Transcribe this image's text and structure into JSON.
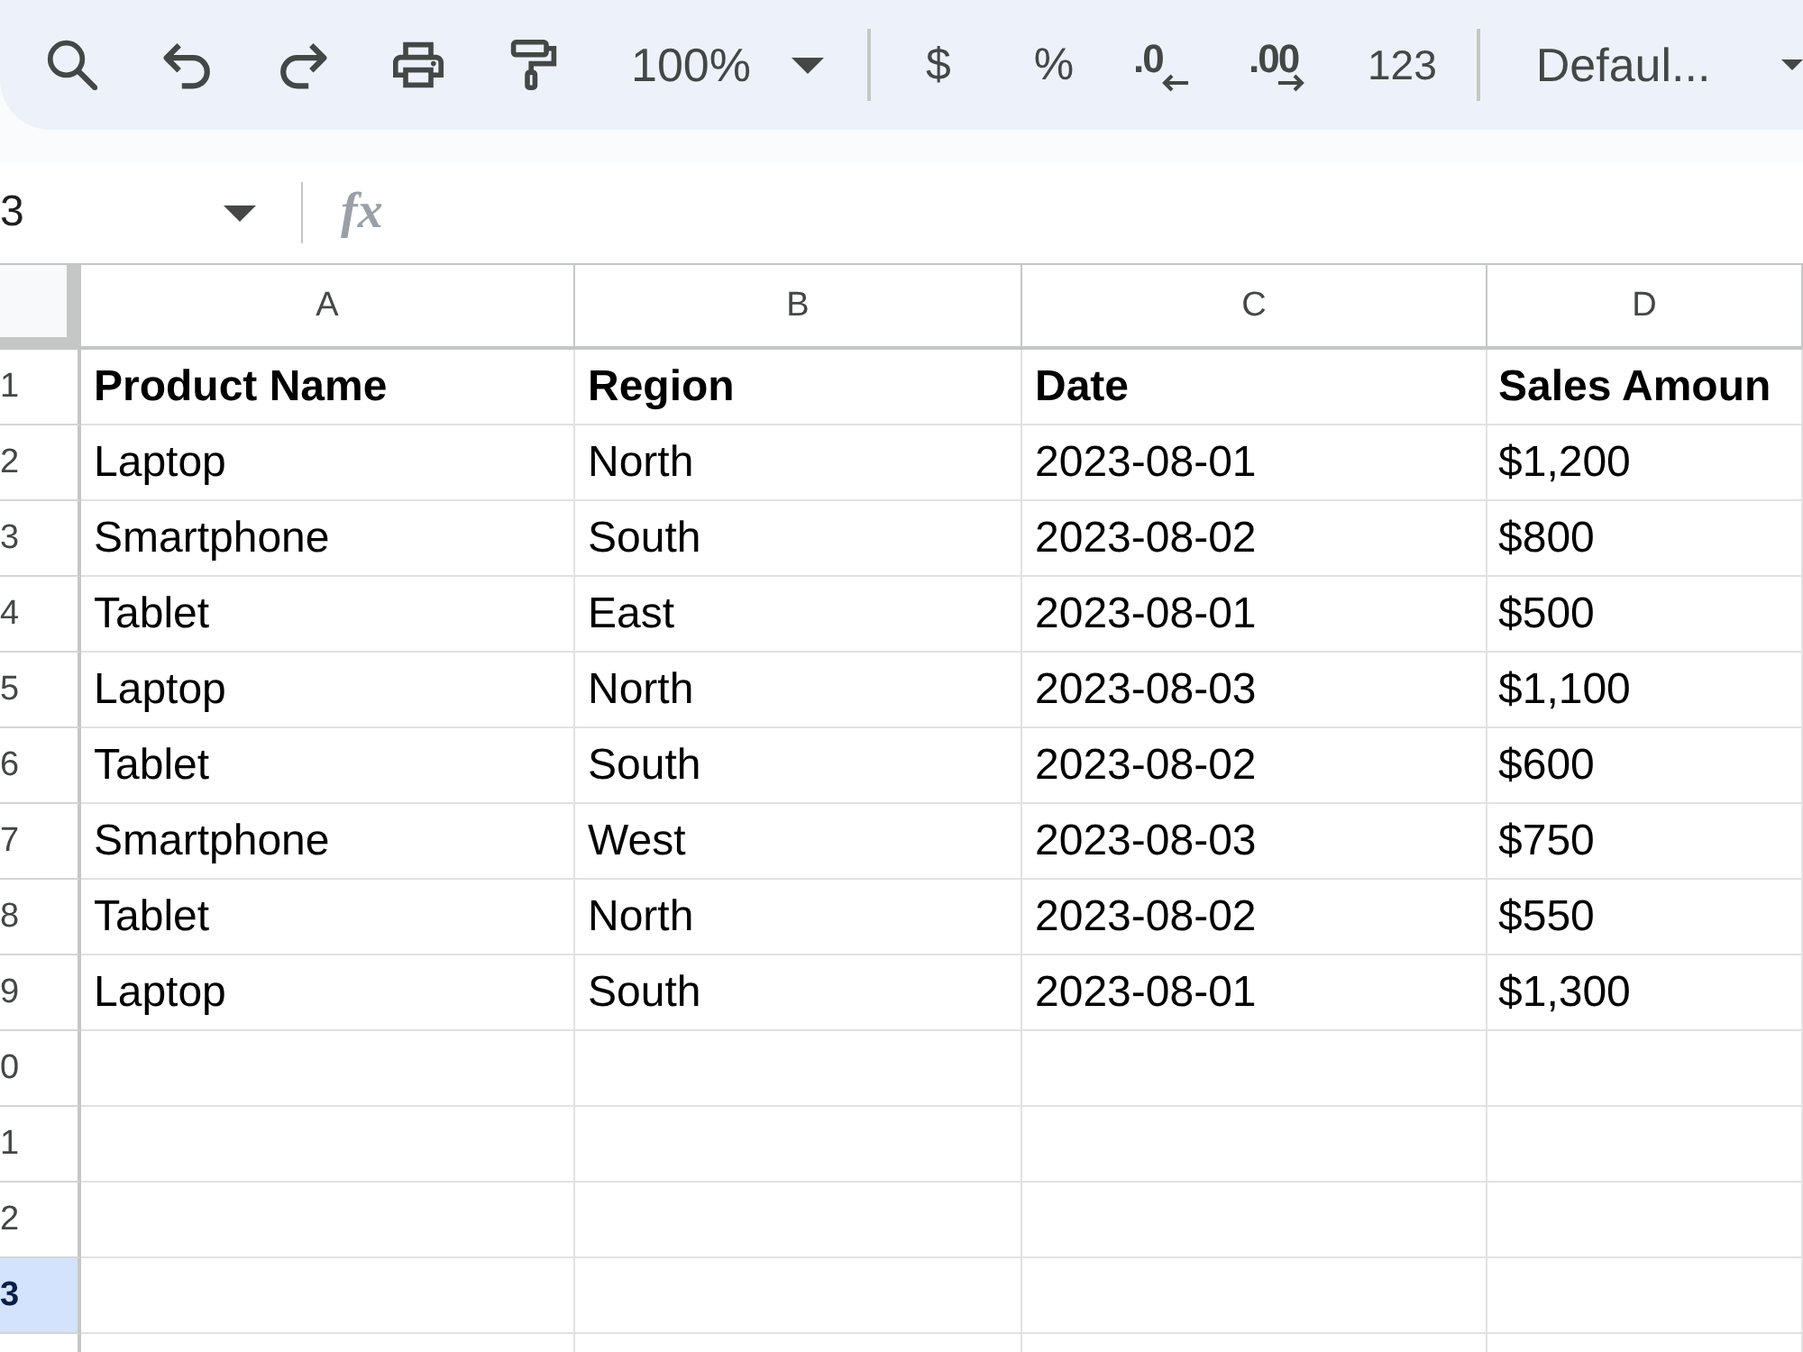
{
  "toolbar": {
    "zoom": "100%",
    "currency": "$",
    "percent": "%",
    "decrease_decimal": ".0",
    "increase_decimal": ".00",
    "number_format": "123",
    "font": "Defaul..."
  },
  "formula_bar": {
    "name_box": "3",
    "function_label": "fx"
  },
  "sheet": {
    "columns": [
      "A",
      "B",
      "C",
      "D"
    ],
    "rows": [
      {
        "number": "1",
        "selected": false,
        "bold": true,
        "cells": [
          "Product Name",
          "Region",
          "Date",
          "Sales Amoun"
        ]
      },
      {
        "number": "2",
        "selected": false,
        "bold": false,
        "cells": [
          "Laptop",
          "North",
          "2023-08-01",
          "$1,200"
        ]
      },
      {
        "number": "3",
        "selected": false,
        "bold": false,
        "cells": [
          "Smartphone",
          "South",
          "2023-08-02",
          "$800"
        ]
      },
      {
        "number": "4",
        "selected": false,
        "bold": false,
        "cells": [
          "Tablet",
          "East",
          "2023-08-01",
          "$500"
        ]
      },
      {
        "number": "5",
        "selected": false,
        "bold": false,
        "cells": [
          "Laptop",
          "North",
          "2023-08-03",
          "$1,100"
        ]
      },
      {
        "number": "6",
        "selected": false,
        "bold": false,
        "cells": [
          "Tablet",
          "South",
          "2023-08-02",
          "$600"
        ]
      },
      {
        "number": "7",
        "selected": false,
        "bold": false,
        "cells": [
          "Smartphone",
          "West",
          "2023-08-03",
          "$750"
        ]
      },
      {
        "number": "8",
        "selected": false,
        "bold": false,
        "cells": [
          "Tablet",
          "North",
          "2023-08-02",
          "$550"
        ]
      },
      {
        "number": "9",
        "selected": false,
        "bold": false,
        "cells": [
          "Laptop",
          "South",
          "2023-08-01",
          "$1,300"
        ]
      },
      {
        "number": "0",
        "selected": false
      },
      {
        "number": "1",
        "selected": false
      },
      {
        "number": "2",
        "selected": false
      },
      {
        "number": "3",
        "selected": true
      }
    ]
  }
}
